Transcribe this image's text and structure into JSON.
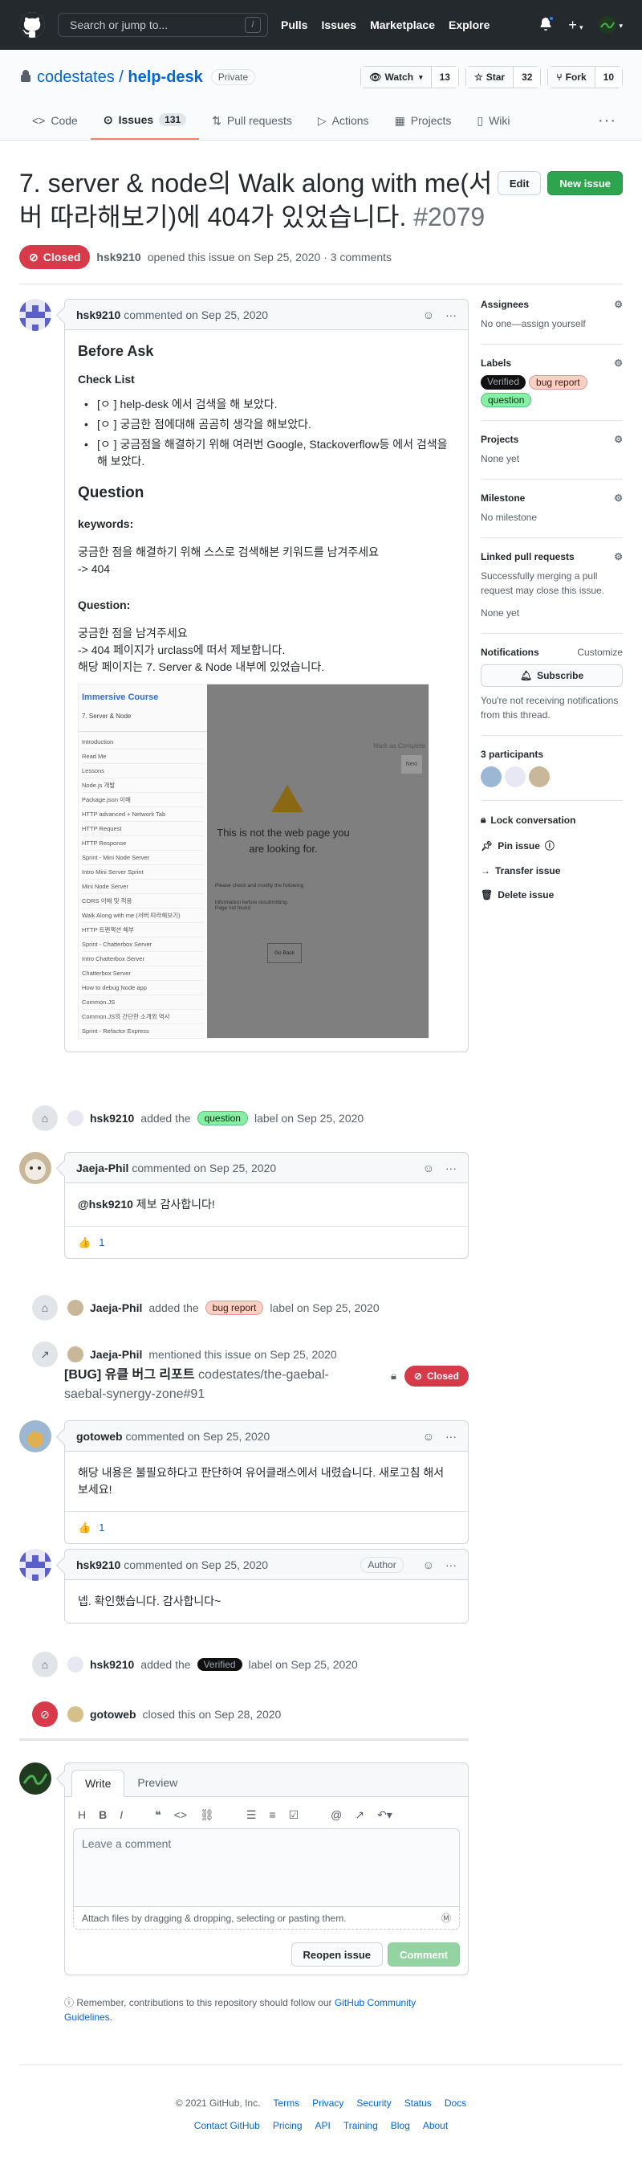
{
  "header": {
    "search_placeholder": "Search or jump to...",
    "search_shortcut": "/",
    "nav": [
      "Pulls",
      "Issues",
      "Marketplace",
      "Explore"
    ]
  },
  "repo": {
    "owner": "codestates",
    "sep": "/",
    "name": "help-desk",
    "visibility": "Private",
    "watch_label": "Watch",
    "watch_count": "13",
    "star_label": "Star",
    "star_count": "32",
    "fork_label": "Fork",
    "fork_count": "10"
  },
  "tabs": [
    {
      "label": "Code",
      "icon": "code-icon"
    },
    {
      "label": "Issues",
      "icon": "issue-icon",
      "count": "131"
    },
    {
      "label": "Pull requests",
      "icon": "pr-icon"
    },
    {
      "label": "Actions",
      "icon": "play-icon"
    },
    {
      "label": "Projects",
      "icon": "project-icon"
    },
    {
      "label": "Wiki",
      "icon": "book-icon"
    }
  ],
  "issue": {
    "title": "7. server & node의 Walk along with me(서버 따라해보기)에 404가 있었습니다.",
    "number": "#2079",
    "edit_label": "Edit",
    "new_issue_label": "New issue",
    "state": "Closed",
    "author": "hsk9210",
    "meta": "opened this issue on Sep 25, 2020 · 3 comments"
  },
  "comment1": {
    "author": "hsk9210",
    "meta": "commented on Sep 25, 2020",
    "h_before": "Before Ask",
    "h_checklist": "Check List",
    "checks": [
      "[ㅇ ] help-desk 에서 검색을 해 보았다.",
      "[ㅇ ] 궁금한 점에대해 곰곰히 생각을 해보았다.",
      "[ㅇ ] 궁금점을 해결하기 위해 여러번 Google, Stackoverflow등 에서 검색을 해 보았다."
    ],
    "h_question": "Question",
    "h_keywords": "keywords:",
    "keywords_text": "궁금한 점을 해결하기 위해 스스로 검색해본 키워드를 남겨주세요",
    "keywords_value": "-> 404",
    "h_question2": "Question:",
    "q_line1": "궁금한 점을 남겨주세요",
    "q_line2": "-> 404 페이지가 urclass에 떠서 제보합니다.",
    "q_line3": "해당 페이지는 7. Server & Node 내부에 있었습니다.",
    "shot": {
      "course": "Immersive Course",
      "unit": "7. Server & Node",
      "sections": [
        "Introduction",
        "Read Me",
        "Lessons",
        "Node.js 개발",
        "Package.json 이해",
        "HTTP advanced + Network Tab",
        "HTTP Request",
        "HTTP Response",
        "Sprint - Mini Node Server",
        "Intro Mini Server Sprint",
        "Mini Node Server",
        "CORS 이해 및 적용",
        "Walk Along with me (서버 따라해보기)",
        "HTTP 트랜잭션 해부",
        "Sprint - Chatterbox Server",
        "Intro Chatterbox Server",
        "Chatterbox Server",
        "How to debug Node app",
        "Common.JS",
        "Common.JS의 간단한 소개와 역사",
        "Sprint - Refactor Express"
      ],
      "mark_complete": "Mark as Complete",
      "next": "Next",
      "error_title": "This is not the web page you are looking for.",
      "error_sub": "Please check and modify the following information before resubmitting.",
      "error_code": "Page not found",
      "go_back": "Go Back"
    }
  },
  "event1": {
    "actor": "hsk9210",
    "pre": "added the",
    "label": "question",
    "post": "label on Sep 25, 2020"
  },
  "comment2": {
    "author": "Jaeja-Phil",
    "meta": "commented on Sep 25, 2020",
    "mention": "@hsk9210",
    "body": " 제보 감사합니다!",
    "reaction_count": "1"
  },
  "event2": {
    "actor": "Jaeja-Phil",
    "pre": "added the",
    "label": "bug report",
    "post": "label on Sep 25, 2020"
  },
  "event3": {
    "actor": "Jaeja-Phil",
    "text": "mentioned this issue on Sep 25, 2020",
    "ref_title": "[BUG] 유클 버그 리포트",
    "ref_repo": "codestates/the-gaebal-saebal-synergy-zone#91",
    "ref_state": "Closed"
  },
  "comment3": {
    "author": "gotoweb",
    "meta": "commented on Sep 25, 2020",
    "body": "해당 내용은 불필요하다고 판단하여 유어클래스에서 내렸습니다. 새로고침 해서 보세요!",
    "reaction_count": "1"
  },
  "comment4": {
    "author": "hsk9210",
    "meta": "commented on Sep 25, 2020",
    "badge": "Author",
    "body": "넵. 확인했습니다. 감사합니다~"
  },
  "event4": {
    "actor": "hsk9210",
    "pre": "added the",
    "label": "Verified",
    "post": "label on Sep 25, 2020"
  },
  "event5": {
    "actor": "gotoweb",
    "text": "closed this on Sep 28, 2020"
  },
  "editor": {
    "tab_write": "Write",
    "tab_preview": "Preview",
    "placeholder": "Leave a comment",
    "attach_text": "Attach files by dragging & dropping, selecting or pasting them.",
    "reopen_label": "Reopen issue",
    "comment_label": "Comment",
    "note_pre": "Remember, contributions to this repository should follow our ",
    "note_link": "GitHub Community Guidelines",
    "note_post": "."
  },
  "sidebar": {
    "assignees_h": "Assignees",
    "assignees_t": "No one—assign yourself",
    "labels_h": "Labels",
    "labels": [
      "Verified",
      "bug report",
      "question"
    ],
    "projects_h": "Projects",
    "projects_t": "None yet",
    "milestone_h": "Milestone",
    "milestone_t": "No milestone",
    "linked_h": "Linked pull requests",
    "linked_t": "Successfully merging a pull request may close this issue.",
    "linked_none": "None yet",
    "notif_h": "Notifications",
    "notif_customize": "Customize",
    "subscribe": "Subscribe",
    "notif_t": "You're not receiving notifications from this thread.",
    "participants_h": "3 participants",
    "lock": "Lock conversation",
    "pin": "Pin issue",
    "transfer": "Transfer issue",
    "delete": "Delete issue"
  },
  "footer": {
    "copyright": "© 2021 GitHub, Inc.",
    "row1": [
      "Terms",
      "Privacy",
      "Security",
      "Status",
      "Docs"
    ],
    "row2": [
      "Contact GitHub",
      "Pricing",
      "API",
      "Training",
      "Blog",
      "About"
    ]
  },
  "colors": {
    "closed": "#d73a49",
    "green": "#2ea44f",
    "link": "#0366d6",
    "tab_underline": "#f9826c"
  }
}
